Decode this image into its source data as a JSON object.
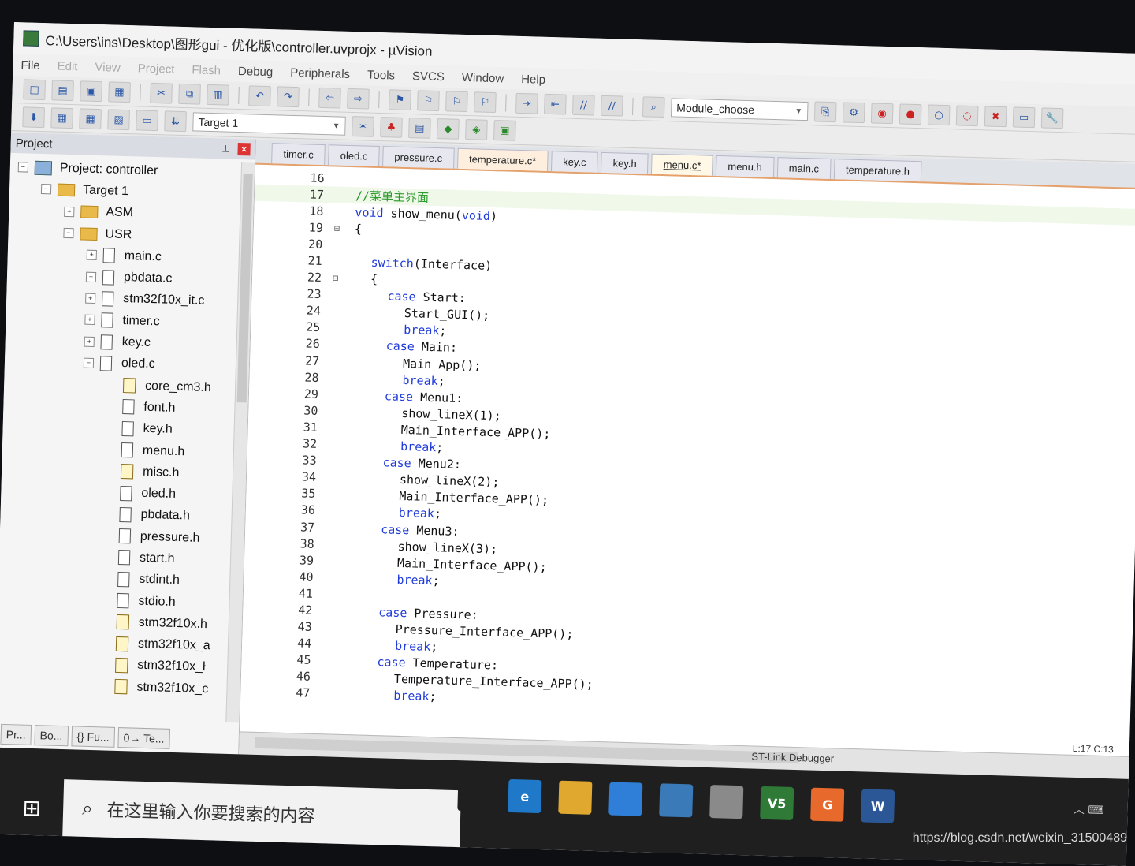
{
  "window": {
    "title": "C:\\Users\\ins\\Desktop\\图形gui - 优化版\\controller.uvprojx - µVision"
  },
  "menu": [
    "File",
    "Edit",
    "View",
    "Project",
    "Flash",
    "Debug",
    "Peripherals",
    "Tools",
    "SVCS",
    "Window",
    "Help"
  ],
  "toolbar": {
    "module_combo": "Module_choose",
    "target_combo": "Target 1"
  },
  "project_pane": {
    "title": "Project",
    "tree": [
      {
        "label": "Project: controller",
        "level": 0,
        "icon": "project-icon",
        "expander": "minus"
      },
      {
        "label": "Target 1",
        "level": 1,
        "icon": "folder-icon",
        "expander": "minus"
      },
      {
        "label": "ASM",
        "level": 2,
        "icon": "folder-icon",
        "expander": "plus"
      },
      {
        "label": "USR",
        "level": 2,
        "icon": "folder-icon",
        "expander": "minus"
      },
      {
        "label": "main.c",
        "level": 3,
        "icon": "file-icon",
        "expander": "plus"
      },
      {
        "label": "pbdata.c",
        "level": 3,
        "icon": "file-icon",
        "expander": "plus"
      },
      {
        "label": "stm32f10x_it.c",
        "level": 3,
        "icon": "file-icon",
        "expander": "plus"
      },
      {
        "label": "timer.c",
        "level": 3,
        "icon": "file-icon",
        "expander": "plus"
      },
      {
        "label": "key.c",
        "level": 3,
        "icon": "file-icon",
        "expander": "plus"
      },
      {
        "label": "oled.c",
        "level": 3,
        "icon": "file-icon",
        "expander": "minus"
      },
      {
        "label": "core_cm3.h",
        "level": 4,
        "icon": "key-file-icon",
        "expander": ""
      },
      {
        "label": "font.h",
        "level": 4,
        "icon": "file-icon",
        "expander": ""
      },
      {
        "label": "key.h",
        "level": 4,
        "icon": "file-icon",
        "expander": ""
      },
      {
        "label": "menu.h",
        "level": 4,
        "icon": "file-icon",
        "expander": ""
      },
      {
        "label": "misc.h",
        "level": 4,
        "icon": "key-file-icon",
        "expander": ""
      },
      {
        "label": "oled.h",
        "level": 4,
        "icon": "file-icon",
        "expander": ""
      },
      {
        "label": "pbdata.h",
        "level": 4,
        "icon": "file-icon",
        "expander": ""
      },
      {
        "label": "pressure.h",
        "level": 4,
        "icon": "file-icon",
        "expander": ""
      },
      {
        "label": "start.h",
        "level": 4,
        "icon": "file-icon",
        "expander": ""
      },
      {
        "label": "stdint.h",
        "level": 4,
        "icon": "file-icon",
        "expander": ""
      },
      {
        "label": "stdio.h",
        "level": 4,
        "icon": "file-icon",
        "expander": ""
      },
      {
        "label": "stm32f10x.h",
        "level": 4,
        "icon": "key-file-icon",
        "expander": ""
      },
      {
        "label": "stm32f10x_a",
        "level": 4,
        "icon": "key-file-icon",
        "expander": ""
      },
      {
        "label": "stm32f10x_ł",
        "level": 4,
        "icon": "key-file-icon",
        "expander": ""
      },
      {
        "label": "stm32f10x_c",
        "level": 4,
        "icon": "key-file-icon",
        "expander": ""
      }
    ],
    "bottom_tabs": [
      "Pr...",
      "Bo...",
      "{} Fu...",
      "0→ Te..."
    ]
  },
  "editor": {
    "tabs": [
      {
        "label": "timer.c",
        "active": false,
        "modified": false
      },
      {
        "label": "oled.c",
        "active": false,
        "modified": false
      },
      {
        "label": "pressure.c",
        "active": false,
        "modified": false
      },
      {
        "label": "temperature.c*",
        "active": false,
        "modified": true
      },
      {
        "label": "key.c",
        "active": false,
        "modified": false
      },
      {
        "label": "key.h",
        "active": false,
        "modified": false
      },
      {
        "label": "menu.c*",
        "active": true,
        "modified": true
      },
      {
        "label": "menu.h",
        "active": false,
        "modified": false
      },
      {
        "label": "main.c",
        "active": false,
        "modified": false
      },
      {
        "label": "temperature.h",
        "active": false,
        "modified": false
      }
    ],
    "lines": [
      {
        "n": "16",
        "fold": "",
        "indent": 0,
        "parts": []
      },
      {
        "n": "17",
        "fold": "",
        "indent": 0,
        "parts": [
          {
            "t": "//菜单主界面",
            "c": "cm"
          }
        ],
        "highlight": true
      },
      {
        "n": "18",
        "fold": "",
        "indent": 0,
        "parts": [
          {
            "t": "void",
            "c": "kw"
          },
          {
            "t": " show_menu(",
            "c": ""
          },
          {
            "t": "void",
            "c": "kw"
          },
          {
            "t": ")",
            "c": ""
          }
        ]
      },
      {
        "n": "19",
        "fold": "⊟",
        "indent": 0,
        "parts": [
          {
            "t": "{",
            "c": ""
          }
        ]
      },
      {
        "n": "20",
        "fold": "",
        "indent": 0,
        "parts": []
      },
      {
        "n": "21",
        "fold": "",
        "indent": 1,
        "parts": [
          {
            "t": "switch",
            "c": "kw"
          },
          {
            "t": "(Interface)",
            "c": ""
          }
        ]
      },
      {
        "n": "22",
        "fold": "⊟",
        "indent": 1,
        "parts": [
          {
            "t": "{",
            "c": ""
          }
        ]
      },
      {
        "n": "23",
        "fold": "",
        "indent": 2,
        "parts": [
          {
            "t": "case",
            "c": "kw"
          },
          {
            "t": " Start:",
            "c": ""
          }
        ]
      },
      {
        "n": "24",
        "fold": "",
        "indent": 3,
        "parts": [
          {
            "t": "Start_GUI();",
            "c": ""
          }
        ]
      },
      {
        "n": "25",
        "fold": "",
        "indent": 3,
        "parts": [
          {
            "t": "break",
            "c": "kw"
          },
          {
            "t": ";",
            "c": ""
          }
        ]
      },
      {
        "n": "26",
        "fold": "",
        "indent": 2,
        "parts": [
          {
            "t": "case",
            "c": "kw"
          },
          {
            "t": " Main:",
            "c": ""
          }
        ]
      },
      {
        "n": "27",
        "fold": "",
        "indent": 3,
        "parts": [
          {
            "t": "Main_App();",
            "c": ""
          }
        ]
      },
      {
        "n": "28",
        "fold": "",
        "indent": 3,
        "parts": [
          {
            "t": "break",
            "c": "kw"
          },
          {
            "t": ";",
            "c": ""
          }
        ]
      },
      {
        "n": "29",
        "fold": "",
        "indent": 2,
        "parts": [
          {
            "t": "case",
            "c": "kw"
          },
          {
            "t": " Menu1:",
            "c": ""
          }
        ]
      },
      {
        "n": "30",
        "fold": "",
        "indent": 3,
        "parts": [
          {
            "t": "show_lineX(1);",
            "c": ""
          }
        ]
      },
      {
        "n": "31",
        "fold": "",
        "indent": 3,
        "parts": [
          {
            "t": "Main_Interface_APP();",
            "c": ""
          }
        ]
      },
      {
        "n": "32",
        "fold": "",
        "indent": 3,
        "parts": [
          {
            "t": "break",
            "c": "kw"
          },
          {
            "t": ";",
            "c": ""
          }
        ]
      },
      {
        "n": "33",
        "fold": "",
        "indent": 2,
        "parts": [
          {
            "t": "case",
            "c": "kw"
          },
          {
            "t": " Menu2:",
            "c": ""
          }
        ]
      },
      {
        "n": "34",
        "fold": "",
        "indent": 3,
        "parts": [
          {
            "t": "show_lineX(2);",
            "c": ""
          }
        ]
      },
      {
        "n": "35",
        "fold": "",
        "indent": 3,
        "parts": [
          {
            "t": "Main_Interface_APP();",
            "c": ""
          }
        ]
      },
      {
        "n": "36",
        "fold": "",
        "indent": 3,
        "parts": [
          {
            "t": "break",
            "c": "kw"
          },
          {
            "t": ";",
            "c": ""
          }
        ]
      },
      {
        "n": "37",
        "fold": "",
        "indent": 2,
        "parts": [
          {
            "t": "case",
            "c": "kw"
          },
          {
            "t": " Menu3:",
            "c": ""
          }
        ]
      },
      {
        "n": "38",
        "fold": "",
        "indent": 3,
        "parts": [
          {
            "t": "show_lineX(3);",
            "c": ""
          }
        ]
      },
      {
        "n": "39",
        "fold": "",
        "indent": 3,
        "parts": [
          {
            "t": "Main_Interface_APP();",
            "c": ""
          }
        ]
      },
      {
        "n": "40",
        "fold": "",
        "indent": 3,
        "parts": [
          {
            "t": "break",
            "c": "kw"
          },
          {
            "t": ";",
            "c": ""
          }
        ]
      },
      {
        "n": "41",
        "fold": "",
        "indent": 0,
        "parts": []
      },
      {
        "n": "42",
        "fold": "",
        "indent": 2,
        "parts": [
          {
            "t": "case",
            "c": "kw"
          },
          {
            "t": " Pressure:",
            "c": ""
          }
        ]
      },
      {
        "n": "43",
        "fold": "",
        "indent": 3,
        "parts": [
          {
            "t": "Pressure_Interface_APP();",
            "c": ""
          }
        ]
      },
      {
        "n": "44",
        "fold": "",
        "indent": 3,
        "parts": [
          {
            "t": "break",
            "c": "kw"
          },
          {
            "t": ";",
            "c": ""
          }
        ]
      },
      {
        "n": "45",
        "fold": "",
        "indent": 2,
        "parts": [
          {
            "t": "case",
            "c": "kw"
          },
          {
            "t": " Temperature:",
            "c": ""
          }
        ]
      },
      {
        "n": "46",
        "fold": "",
        "indent": 3,
        "parts": [
          {
            "t": "Temperature_Interface_APP();",
            "c": ""
          }
        ]
      },
      {
        "n": "47",
        "fold": "",
        "indent": 3,
        "parts": [
          {
            "t": "break",
            "c": "kw"
          },
          {
            "t": ";",
            "c": ""
          }
        ]
      }
    ]
  },
  "status": {
    "debugger": "ST-Link Debugger",
    "position": "L:17 C:13"
  },
  "taskbar": {
    "search_placeholder": "在这里输入你要搜索的内容",
    "apps": [
      {
        "name": "task-view-icon",
        "label": "",
        "color": "#1f1f1f"
      },
      {
        "name": "edge-icon",
        "label": "e",
        "color": "#1f78c8"
      },
      {
        "name": "file-explorer-icon",
        "label": "",
        "color": "#e0a82e"
      },
      {
        "name": "mail-icon",
        "label": "",
        "color": "#2f7fd8"
      },
      {
        "name": "calculator-icon",
        "label": "",
        "color": "#3a7ab8"
      },
      {
        "name": "paint-icon",
        "label": "",
        "color": "#8a8a8a"
      },
      {
        "name": "uvision-icon",
        "label": "V5",
        "color": "#2e7a36"
      },
      {
        "name": "pdf-icon",
        "label": "G",
        "color": "#e8692c"
      },
      {
        "name": "word-icon",
        "label": "W",
        "color": "#2b5797"
      }
    ]
  },
  "watermark": "https://blog.csdn.net/weixin_31500489"
}
